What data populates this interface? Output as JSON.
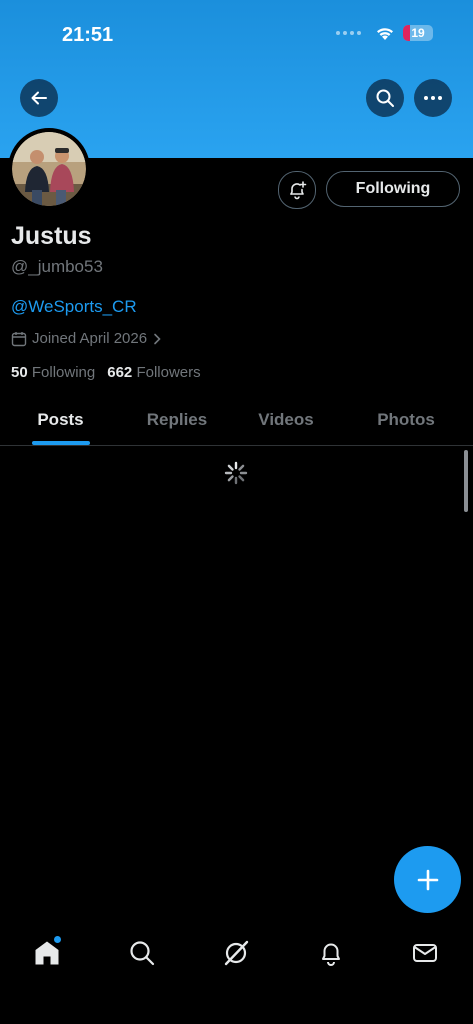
{
  "status_bar": {
    "time": "21:51",
    "battery": "19",
    "battery_color": "#e0245e"
  },
  "profile": {
    "name": "Justus",
    "handle": "@_jumbo53",
    "bio_link": "@WeSports_CR",
    "joined": "Joined April 2026",
    "following_count": "50",
    "following_label": "Following",
    "followers_count": "662",
    "followers_label": "Followers"
  },
  "actions": {
    "follow_label": "Following"
  },
  "tabs": [
    {
      "label": "Posts",
      "active": true
    },
    {
      "label": "Replies",
      "active": false
    },
    {
      "label": "Videos",
      "active": false
    },
    {
      "label": "Photos",
      "active": false
    }
  ],
  "icons": {
    "back": "arrow-left-icon",
    "search": "search-icon",
    "more": "more-horizontal-icon",
    "notify": "bell-plus-icon",
    "compose": "plus-icon",
    "nav": [
      "home-icon",
      "search-icon",
      "grok-icon",
      "bell-icon",
      "mail-icon"
    ]
  },
  "colors": {
    "accent": "#1d9bf0",
    "banner": "#1b8fdc",
    "background": "#000000"
  }
}
